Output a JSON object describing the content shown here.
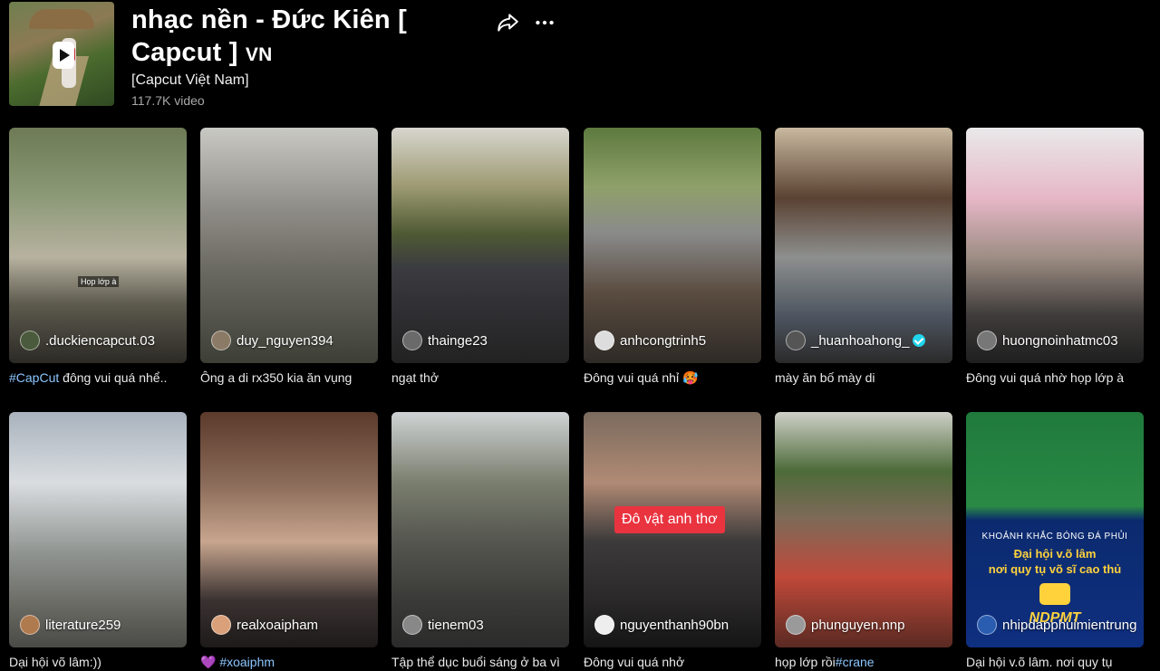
{
  "header": {
    "title": "nhạc nền - Đức Kiên [ Capcut ]",
    "title_suffix": "VN",
    "artist": "[Capcut Việt Nam]",
    "video_count": "117.7K video",
    "icons": [
      "share-icon",
      "more-icon"
    ]
  },
  "videos": [
    {
      "author": ".duckiencapcut.03",
      "desc_tag": "#CapCut",
      "desc": " đông vui quá nhể..",
      "overlay": "Họp lớp à"
    },
    {
      "author": "duy_nguyen394",
      "desc_tag": "",
      "desc": "Ông a di rx350 kia ăn vụng"
    },
    {
      "author": "thainge23",
      "desc_tag": "",
      "desc": "ngạt thở"
    },
    {
      "author": "anhcongtrinh5",
      "desc_tag": "",
      "desc": "Đông vui quá nhỉ 🥵"
    },
    {
      "author": "_huanhoahong_",
      "verified": true,
      "desc_tag": "",
      "desc": "mày ăn bố mày di"
    },
    {
      "author": "huongnoinhatmc03",
      "desc_tag": "",
      "desc": "Đông vui quá nhờ họp lớp à"
    },
    {
      "author": "literature259",
      "desc_tag": "",
      "desc": "Dại hội võ lâm:))"
    },
    {
      "author": "realxoaipham",
      "desc_tag": "#xoaiphm",
      "desc": "💜 "
    },
    {
      "author": "tienem03",
      "desc_tag": "",
      "desc": "Tập thể dục buổi sáng ở ba vì"
    },
    {
      "author": "nguyenthanh90bn",
      "desc_tag": "",
      "desc": "Đông vui quá nhở",
      "overlay": "Đô vật anh thơ"
    },
    {
      "author": "phunguyen.nnp",
      "desc_tag": "#crane",
      "desc": "họp lớp rồi"
    },
    {
      "author": "nhipdapphuimientrung",
      "desc_tag": "",
      "desc": "Dại hội v.õ lâm. nơi quy tụ",
      "banner": {
        "line1": "KHOẢNH KHẮC BÓNG ĐÁ PHỦI",
        "line2": "Đại hội v.õ lâm",
        "line3": "nơi quy tụ võ sĩ cao thủ",
        "line4": "NDPMT"
      }
    }
  ],
  "colors": {
    "background": "#000000",
    "hashtag": "#8bc6ff",
    "verified": "#20d5ec",
    "overlay_red": "#e9333f"
  }
}
